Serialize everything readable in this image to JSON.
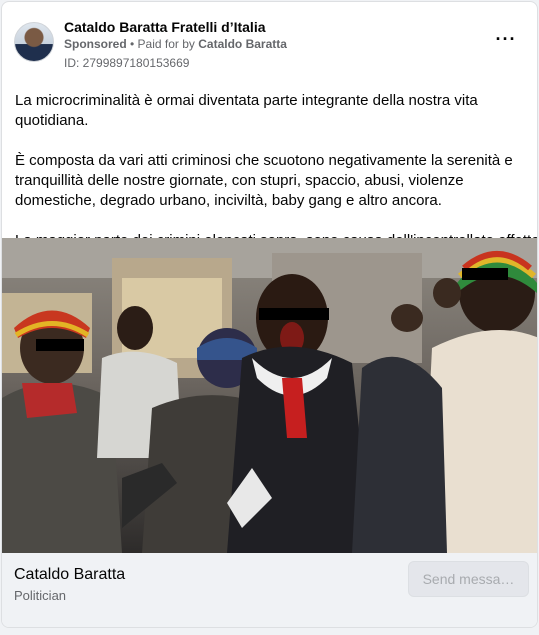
{
  "post": {
    "page_name": "Cataldo Baratta Fratelli d’Italia",
    "sponsored_label": "Sponsored",
    "separator": " • ",
    "paid_for_prefix": "Paid for by ",
    "paid_for_name": "Cataldo Baratta",
    "ad_id": "ID: 2799897180153669",
    "more_icon": "more-horizontal-icon",
    "text": {
      "p1": "La microcriminalità è ormai diventata parte integrante della nostra vita quotidiana.",
      "p2": "È composta da vari atti criminosi che scuotono negativamente la serenità e tranquillità delle nostre giornate, con stupri, spaccio, abusi, violenze domestiche, degrado urbano, inciviltà, baby gang e altro ancora.",
      "p3": "La maggior parte dei crimini elencati sopra, sono causa dell'incontrollato effetto…"
    }
  },
  "footer": {
    "name": "Cataldo Baratta",
    "subtitle": "Politician",
    "send_button": "Send messa…"
  },
  "colors": {
    "text_primary": "#050505",
    "text_secondary": "#65676b",
    "footer_bg": "#f0f2f5",
    "button_disabled_bg": "#e4e6eb",
    "button_disabled_text": "#a8abaf"
  }
}
